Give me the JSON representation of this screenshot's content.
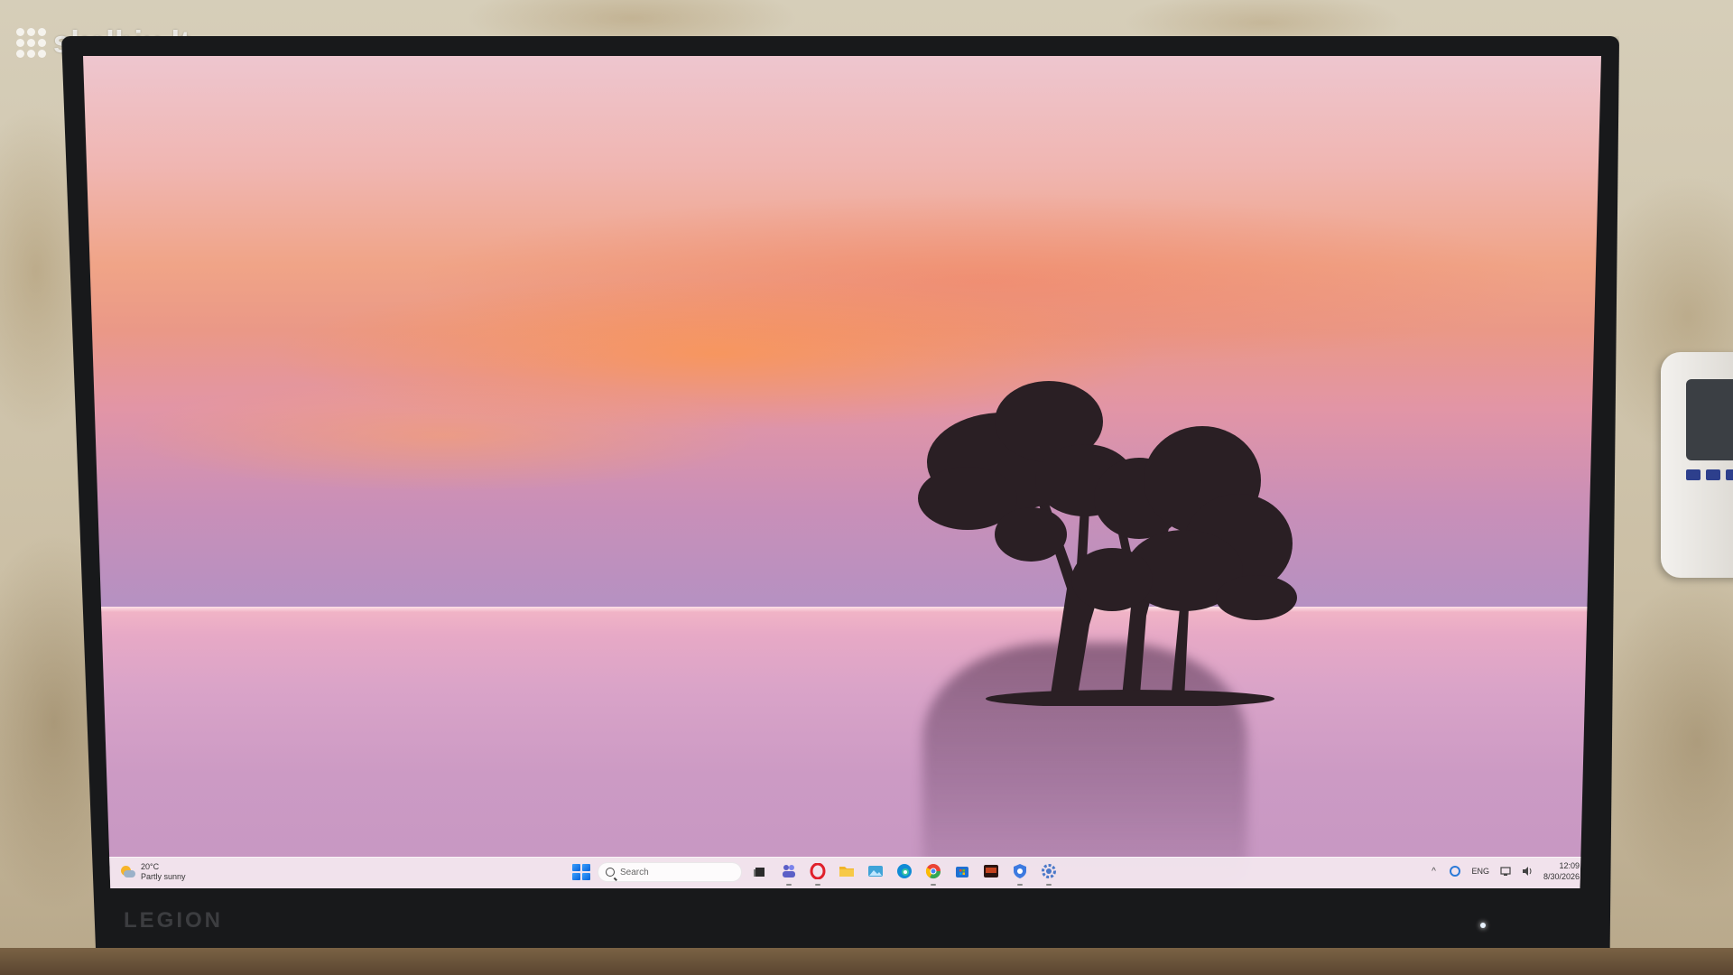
{
  "watermark": {
    "text": "skelbiu.lt"
  },
  "monitor": {
    "brand": "LEGION"
  },
  "taskbar": {
    "weather": {
      "temperature": "20°C",
      "condition": "Partly sunny"
    },
    "search": {
      "placeholder": "Search"
    },
    "apps": [
      {
        "name": "task-view",
        "color": "#2b2b2b"
      },
      {
        "name": "teams",
        "color": "#5b5fc7"
      },
      {
        "name": "opera",
        "color": "#e0202b"
      },
      {
        "name": "file-explorer",
        "color": "#f0b429"
      },
      {
        "name": "photos",
        "color": "#3fa3d8"
      },
      {
        "name": "edge",
        "color": "#0f8bd6"
      },
      {
        "name": "chrome",
        "color": "#34a853"
      },
      {
        "name": "store",
        "color": "#1f6fd1"
      },
      {
        "name": "media-app",
        "color": "#8a2b1a"
      },
      {
        "name": "shield-app",
        "color": "#3d7ae0"
      },
      {
        "name": "settings",
        "color": "#4a78c8"
      }
    ],
    "tray": {
      "language": "ENG",
      "time": "12:09",
      "date": "8/30/2026"
    }
  }
}
